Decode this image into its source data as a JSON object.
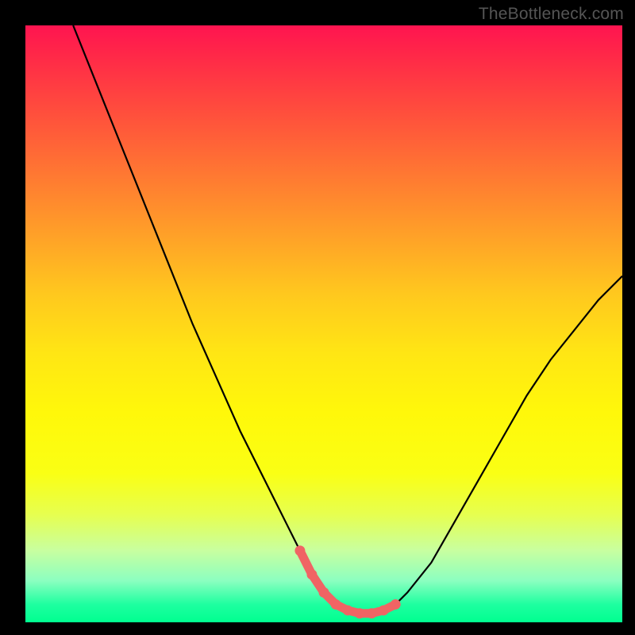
{
  "watermark": "TheBottleneck.com",
  "chart_data": {
    "type": "line",
    "title": "",
    "xlabel": "",
    "ylabel": "",
    "xlim": [
      0,
      100
    ],
    "ylim": [
      0,
      100
    ],
    "grid": false,
    "series": [
      {
        "name": "curve",
        "color": "#000000",
        "x": [
          8,
          12,
          16,
          20,
          24,
          28,
          32,
          36,
          40,
          44,
          46,
          48,
          50,
          52,
          54,
          56,
          58,
          60,
          62,
          64,
          68,
          72,
          76,
          80,
          84,
          88,
          92,
          96,
          100
        ],
        "values": [
          100,
          90,
          80,
          70,
          60,
          50,
          41,
          32,
          24,
          16,
          12,
          8,
          5,
          3,
          2,
          1.5,
          1.5,
          2,
          3,
          5,
          10,
          17,
          24,
          31,
          38,
          44,
          49,
          54,
          58
        ]
      },
      {
        "name": "highlight",
        "color": "#f06464",
        "x": [
          46,
          48,
          50,
          52,
          54,
          56,
          58,
          60,
          62
        ],
        "values": [
          12,
          8,
          5,
          3,
          2,
          1.5,
          1.5,
          2,
          3
        ]
      }
    ],
    "background_gradient": {
      "top_color": "#ff1450",
      "mid_color": "#fff000",
      "bottom_color": "#00ff90"
    }
  }
}
